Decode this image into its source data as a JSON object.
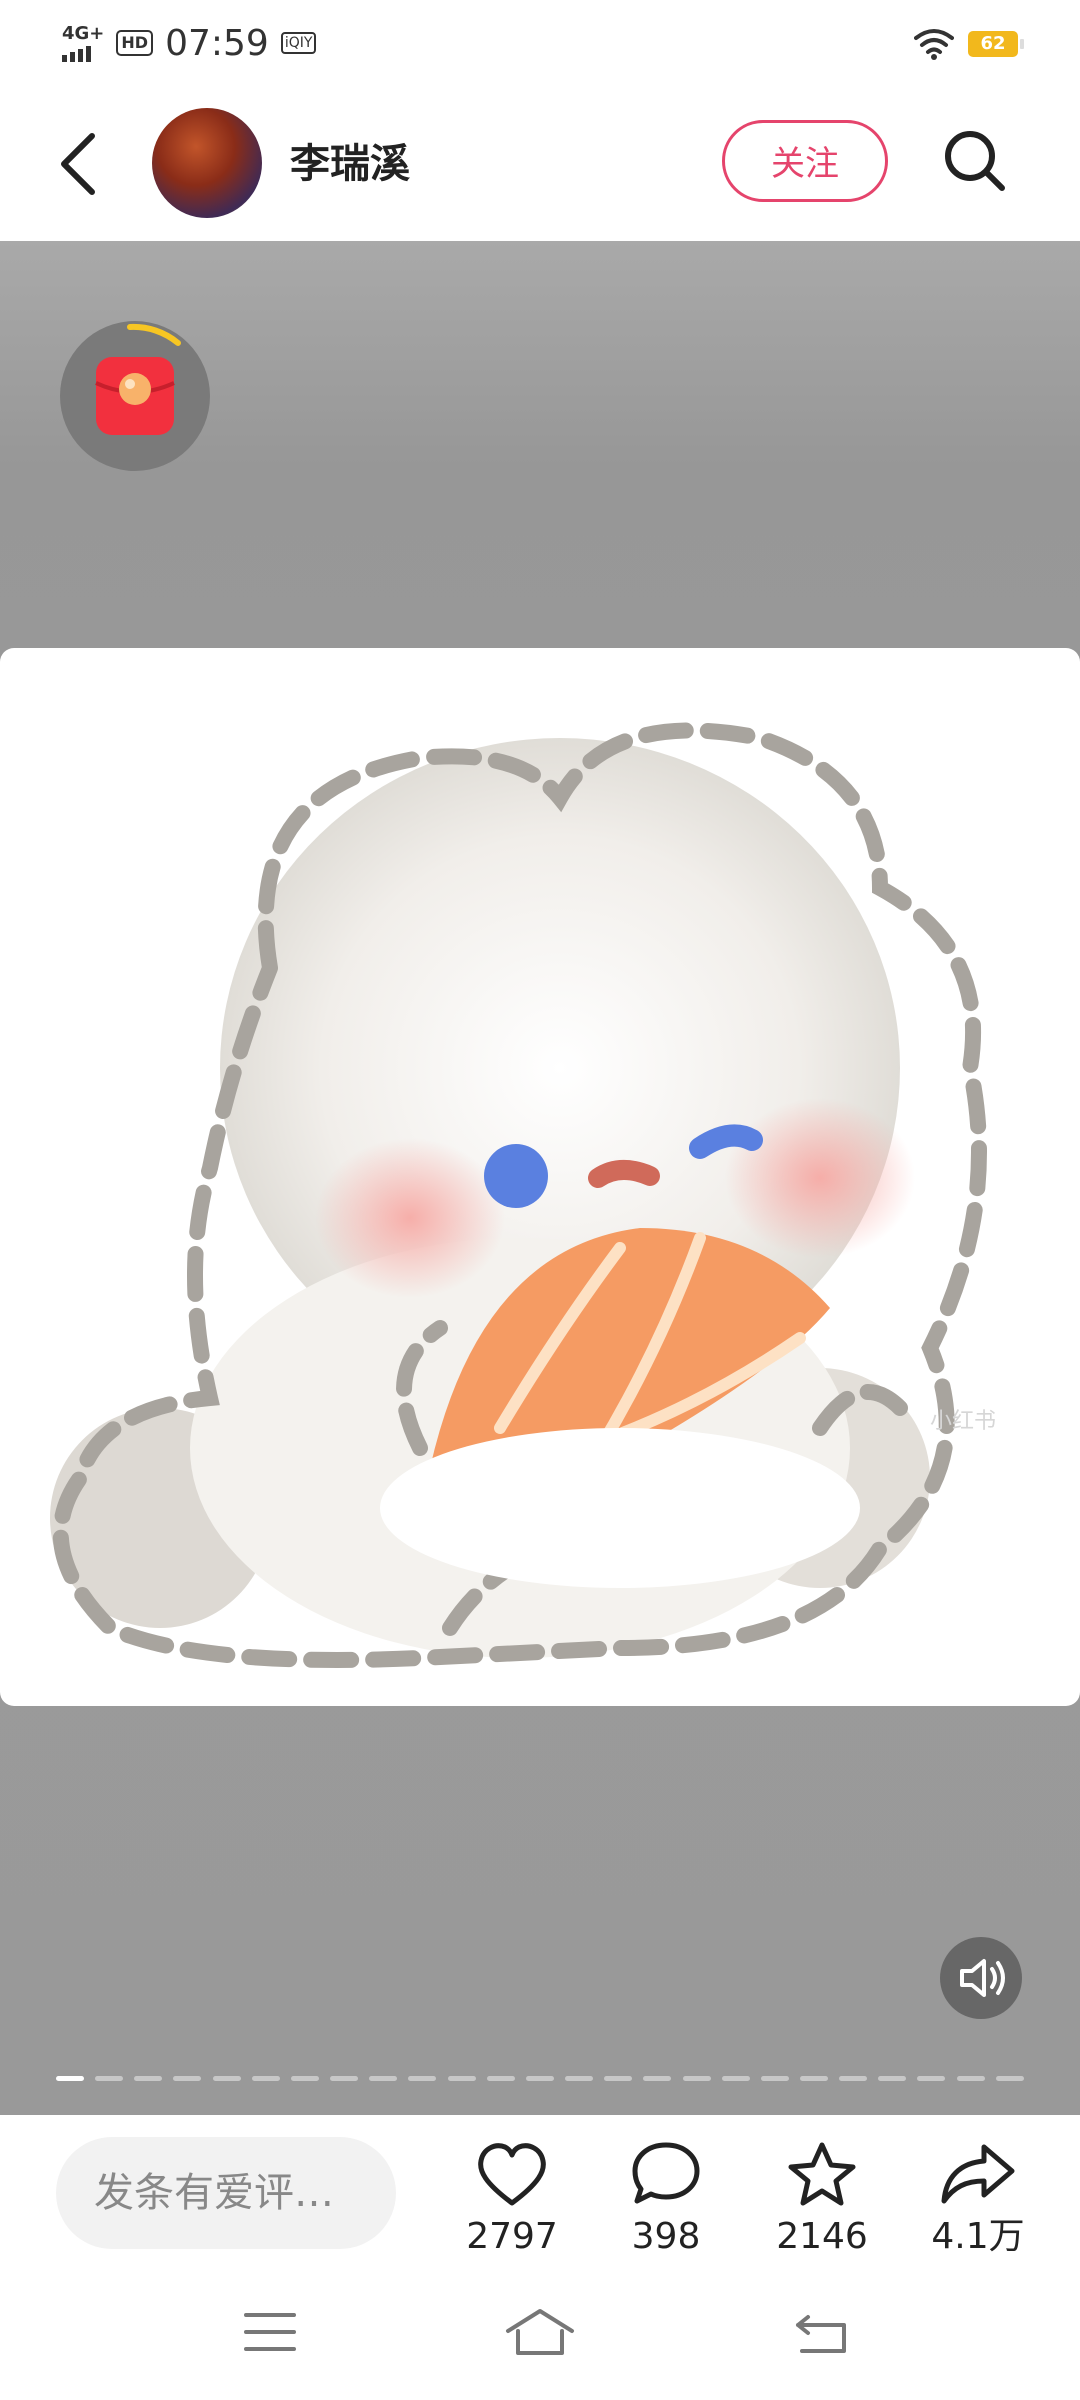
{
  "status_bar": {
    "network": "4G+",
    "hd_badge": "HD",
    "time": "07:59",
    "app_badge": "iQIY",
    "battery": "62"
  },
  "header": {
    "author_name": "李瑞溪",
    "follow_label": "关注"
  },
  "media": {
    "page_count": 25,
    "current_page": 1
  },
  "action_bar": {
    "comment_placeholder": "发条有爱评…",
    "like_count": "2797",
    "comment_count": "398",
    "favorite_count": "2146",
    "share_count": "4.1万"
  },
  "icons": [
    "back-arrow-icon",
    "avatar",
    "search-icon",
    "red-packet-icon",
    "mute-speaker-icon",
    "heart-icon",
    "comment-bubble-icon",
    "star-icon",
    "share-arrow-icon",
    "menu-icon",
    "home-icon",
    "back-nav-icon",
    "wifi-icon",
    "signal-icon"
  ],
  "colors": {
    "accent": "#e5446c",
    "battery": "#f2b81c"
  }
}
